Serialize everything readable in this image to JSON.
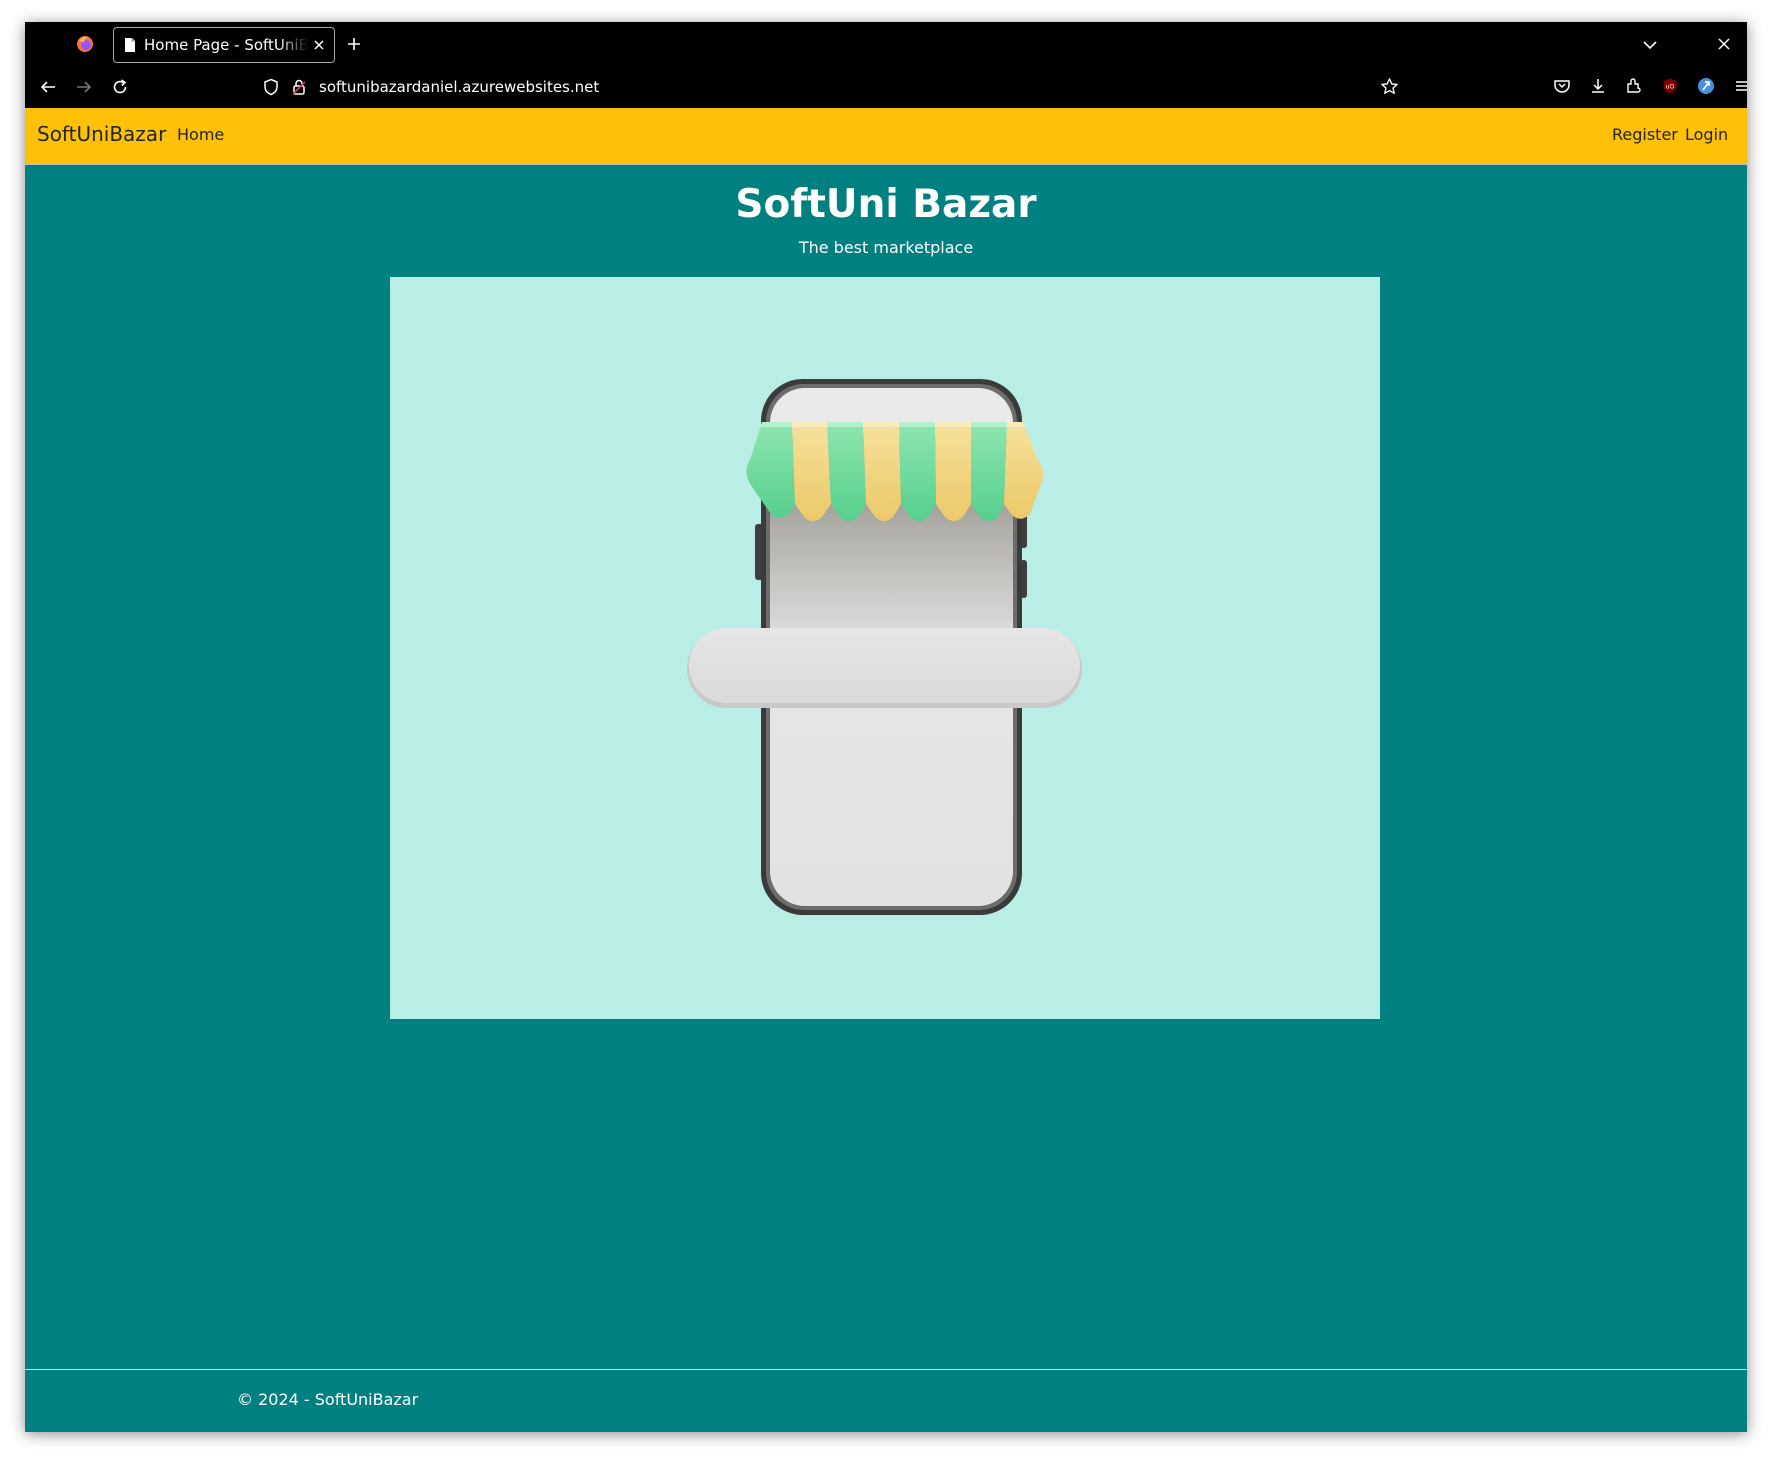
{
  "browser": {
    "tab_title": "Home Page - SoftUniBazar",
    "url": "softunibazardaniel.azurewebsites.net"
  },
  "navbar": {
    "brand": "SoftUniBazar",
    "links": [
      "Home"
    ],
    "right_links": [
      "Register",
      "Login"
    ],
    "background_color": "#ffc107"
  },
  "hero": {
    "title": "SoftUni Bazar",
    "subtitle": "The best marketplace",
    "image_icon": "phone-storefront-illustration"
  },
  "footer": {
    "text": "© 2024 - SoftUniBazar"
  },
  "colors": {
    "page_background": "#008080",
    "image_background": "#b8eee5"
  }
}
